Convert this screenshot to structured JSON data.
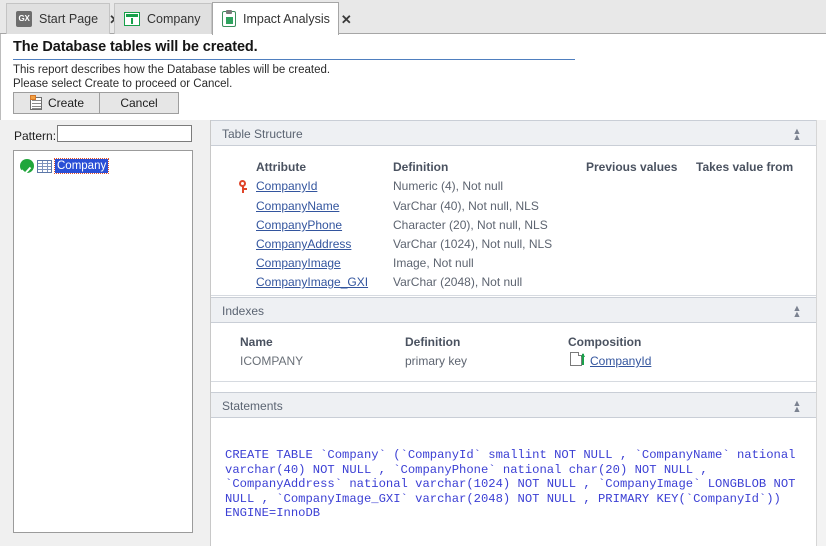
{
  "tabs": [
    {
      "label": "Start Page",
      "icon": "gx-logo-icon",
      "active": false,
      "closable": true
    },
    {
      "label": "Company",
      "icon": "table-grid-icon",
      "active": false,
      "closable": true
    },
    {
      "label": "Impact Analysis",
      "icon": "clipboard-icon",
      "active": true,
      "closable": true
    }
  ],
  "report": {
    "title": "The Database tables will be created.",
    "description_line1": "This report describes how the Database tables will be created.",
    "description_line2": "Please select Create to proceed or Cancel.",
    "create_label": "Create",
    "cancel_label": "Cancel"
  },
  "left_panel": {
    "pattern_label": "Pattern:",
    "pattern_value": "",
    "pattern_placeholder": "",
    "tree": [
      {
        "label": "Company",
        "status": "ok",
        "selected": true
      }
    ]
  },
  "sections": {
    "table_structure": {
      "title": "Table Structure",
      "collapse_icon": "double-chevron-up-icon",
      "columns": [
        "Attribute",
        "Definition",
        "Previous values",
        "Takes value from"
      ],
      "rows": [
        {
          "attribute": "CompanyId",
          "definition": "Numeric (4), Not null",
          "previous_values": "",
          "takes_value_from": "",
          "key": true
        },
        {
          "attribute": "CompanyName",
          "definition": "VarChar (40), Not null, NLS",
          "previous_values": "",
          "takes_value_from": "",
          "key": false
        },
        {
          "attribute": "CompanyPhone",
          "definition": "Character (20), Not null, NLS",
          "previous_values": "",
          "takes_value_from": "",
          "key": false
        },
        {
          "attribute": "CompanyAddress",
          "definition": "VarChar (1024), Not null, NLS",
          "previous_values": "",
          "takes_value_from": "",
          "key": false
        },
        {
          "attribute": "CompanyImage",
          "definition": "Image, Not null",
          "previous_values": "",
          "takes_value_from": "",
          "key": false
        },
        {
          "attribute": "CompanyImage_GXI",
          "definition": "VarChar (2048), Not null",
          "previous_values": "",
          "takes_value_from": "",
          "key": false
        }
      ]
    },
    "indexes": {
      "title": "Indexes",
      "collapse_icon": "double-chevron-up-icon",
      "columns": [
        "Name",
        "Definition",
        "Composition"
      ],
      "rows": [
        {
          "name": "ICOMPANY",
          "definition": "primary key",
          "composition": "CompanyId",
          "composition_icon": "page-ascending-icon"
        }
      ]
    },
    "statements": {
      "title": "Statements",
      "collapse_icon": "double-chevron-up-icon",
      "sql": "CREATE TABLE `Company` (`CompanyId` smallint NOT NULL , `CompanyName` national varchar(40) NOT NULL , `CompanyPhone` national char(20) NOT NULL , `CompanyAddress` national varchar(1024) NOT NULL , `CompanyImage` LONGBLOB NOT NULL , `CompanyImage_GXI` varchar(2048) NOT NULL , PRIMARY KEY(`CompanyId`)) ENGINE=InnoDB"
    }
  },
  "colors": {
    "accent_link": "#33559e",
    "sql_text": "#3b3fd4",
    "section_header_bg": "#eef0f3",
    "selection_blue": "#2a4fd6",
    "status_green": "#21a63c",
    "key_red": "#e0452a",
    "rule_blue": "#4f7fbf"
  }
}
